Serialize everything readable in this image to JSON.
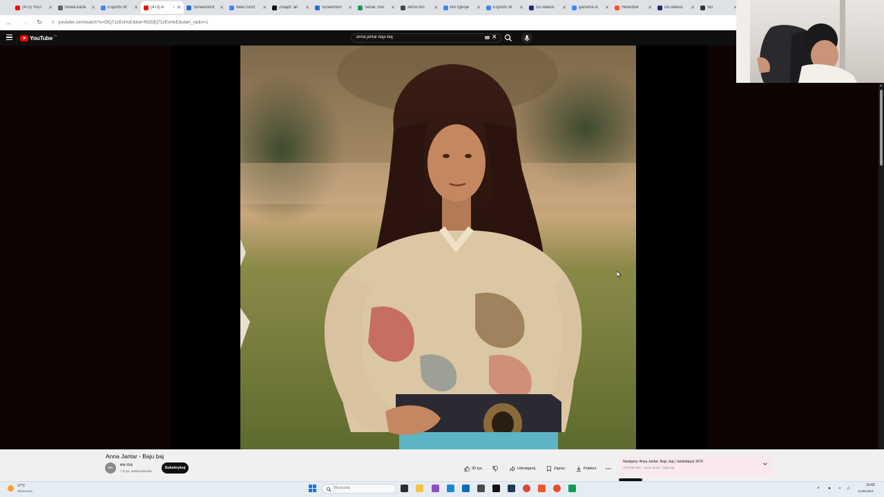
{
  "browser": {
    "tabs": [
      {
        "label": "(473) YouT",
        "favicon": "youtube-icon",
        "color": "#ff0000",
        "active": false
      },
      {
        "label": "Nowa karta",
        "favicon": "chrome-icon",
        "color": "#5f6368",
        "active": false
      },
      {
        "label": "Esports W",
        "favicon": "doc-icon",
        "color": "#4285f4",
        "active": false
      },
      {
        "label": "(473) A",
        "favicon": "youtube-icon",
        "color": "#ff0000",
        "active": true
      },
      {
        "label": "Screenshot",
        "favicon": "screenshot-icon",
        "color": "#3367d6",
        "active": false
      },
      {
        "label": "Iwan Groz",
        "favicon": "google-icon",
        "color": "#4285f4",
        "active": false
      },
      {
        "label": "Znajdź 'an",
        "favicon": "tiktok-icon",
        "color": "#000000",
        "active": false
      },
      {
        "label": "Screensho",
        "favicon": "screenshot-icon",
        "color": "#3367d6",
        "active": false
      },
      {
        "label": "Serial: Glo",
        "favicon": "sheets-icon",
        "color": "#0f9d58",
        "active": false
      },
      {
        "label": "skmo-fun",
        "favicon": "site-icon",
        "color": "#444444",
        "active": false
      },
      {
        "label": "kto zgnoje",
        "favicon": "google-icon",
        "color": "#4285f4",
        "active": false
      },
      {
        "label": "Esports W",
        "favicon": "doc-icon",
        "color": "#4285f4",
        "active": false
      },
      {
        "label": "Do wiekor",
        "favicon": "site-icon",
        "color": "#1e2a78",
        "active": false
      },
      {
        "label": "garnima lo",
        "favicon": "google-icon",
        "color": "#4285f4",
        "active": false
      },
      {
        "label": "Herenbor",
        "favicon": "brave-icon",
        "color": "#fb542b",
        "active": false
      },
      {
        "label": "Do wiekor",
        "favicon": "site-icon",
        "color": "#1e2a78",
        "active": false
      },
      {
        "label": "Sci",
        "favicon": "site-icon",
        "color": "#333333",
        "active": false
      }
    ],
    "url": "youtube.com/watch?v=DEj71zExHoE&list=RDDEj71zExHoE&start_radio=1"
  },
  "youtube": {
    "logo_text": "YouTube",
    "region": "PL",
    "search_value": "anna jantar baju baj"
  },
  "video": {
    "title": "Anna Jantar - Baju baj",
    "channel_name": "ew ma",
    "channel_initials": "ew",
    "channel_subs": "7,9 tys. subskrybentów",
    "subscribe_label": "Subskrybuj",
    "likes": "30 tys.",
    "share_label": "Udostępnij",
    "save_label": "Zapisz",
    "download_label": "Pobierz"
  },
  "up_next": {
    "title": "Następny: Anna Jantar- Baju, baj ( Jambalaya) 1976",
    "subtitle": "YouTube Mix · Anna Jantar - Baju baj"
  },
  "taskbar": {
    "weather_temp": "17°C",
    "weather_desc": "Słonecznie",
    "search_placeholder": "Wyszukaj",
    "time": "10:43",
    "date": "11.08.2024"
  }
}
